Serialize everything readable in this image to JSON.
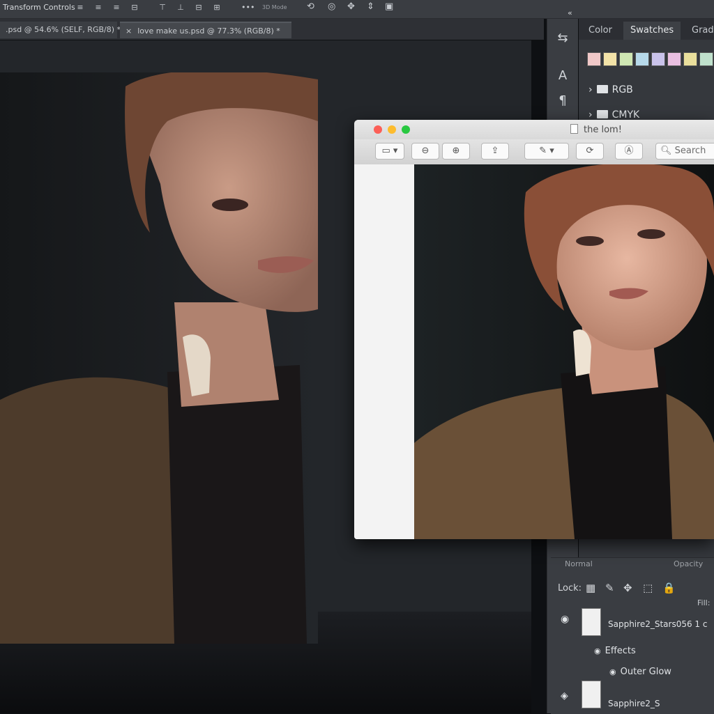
{
  "options_bar": {
    "transform_label": "Transform Controls",
    "mode_3d_label": "3D Mode"
  },
  "document_tabs": [
    {
      "label": ".psd @ 54.6% (SELF, RGB/8) *"
    },
    {
      "label": "love make us.psd @ 77.3% (RGB/8) *",
      "close": "×"
    }
  ],
  "tools": {
    "collapse": "«"
  },
  "right_panel": {
    "tabs": [
      "Color",
      "Swatches",
      "Grad"
    ],
    "swatch_colors": [
      "#f0c8c8",
      "#f3e3a8",
      "#cfe7b3",
      "#b6d9ea",
      "#c9c2ea",
      "#e9bfe1",
      "#eadf9c",
      "#bfe0cc",
      "#a8d6de",
      "#f1e4a2"
    ],
    "folders": [
      {
        "label": "RGB"
      },
      {
        "label": "CMYK"
      }
    ]
  },
  "layers": {
    "blend_mode": "Normal",
    "opacity_label": "Opacity",
    "lock_label": "Lock:",
    "fill_label": "Fill:",
    "rows": [
      {
        "name": "Sapphire2_Stars056 1 c"
      },
      {
        "name": "Sapphire2_S"
      }
    ],
    "effects_label": "Effects",
    "outer_glow_label": "Outer Glow"
  },
  "preview_window": {
    "title": "the lom!",
    "search_label": "Search"
  }
}
